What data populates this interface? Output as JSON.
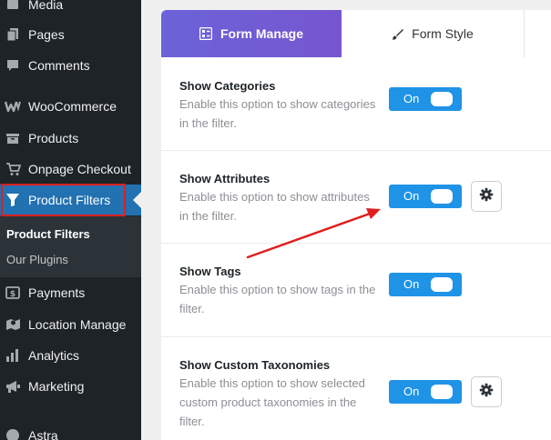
{
  "sidebar": {
    "items": [
      {
        "label": "Media",
        "icon": "media-icon"
      },
      {
        "label": "Pages",
        "icon": "pages-icon"
      },
      {
        "label": "Comments",
        "icon": "comments-icon"
      },
      {
        "label": "WooCommerce",
        "icon": "woocommerce-icon"
      },
      {
        "label": "Products",
        "icon": "products-icon"
      },
      {
        "label": "Onpage Checkout",
        "icon": "cart-icon"
      },
      {
        "label": "Product Filters",
        "icon": "filter-icon",
        "active": true
      },
      {
        "label": "Payments",
        "icon": "payments-icon"
      },
      {
        "label": "Location Manage",
        "icon": "location-icon"
      },
      {
        "label": "Analytics",
        "icon": "analytics-icon"
      },
      {
        "label": "Marketing",
        "icon": "megaphone-icon"
      },
      {
        "label": "Astra",
        "icon": "astra-icon"
      }
    ],
    "submenu": [
      {
        "label": "Product Filters",
        "current": true
      },
      {
        "label": "Our Plugins"
      }
    ]
  },
  "tabs": [
    {
      "label": "Form Manage",
      "icon": "form-manage-icon",
      "active": true
    },
    {
      "label": "Form Style",
      "icon": "brush-icon"
    }
  ],
  "options": [
    {
      "title": "Show Categories",
      "description": "Enable this option to show categories in the filter.",
      "toggle": "On",
      "settings": false
    },
    {
      "title": "Show Attributes",
      "description": "Enable this option to show attributes in the filter.",
      "toggle": "On",
      "settings": true
    },
    {
      "title": "Show Tags",
      "description": "Enable this option to show tags in the filter.",
      "toggle": "On",
      "settings": false
    },
    {
      "title": "Show Custom Taxonomies",
      "description": "Enable this option to show selected custom product taxonomies in the filter.",
      "toggle": "On",
      "settings": true
    }
  ],
  "colors": {
    "sidebar_bg": "#1d2327",
    "active_menu": "#2271b1",
    "highlight": "#e01e1e",
    "tab_gradient_start": "#6b63d9",
    "toggle_on": "#1f93e6"
  }
}
